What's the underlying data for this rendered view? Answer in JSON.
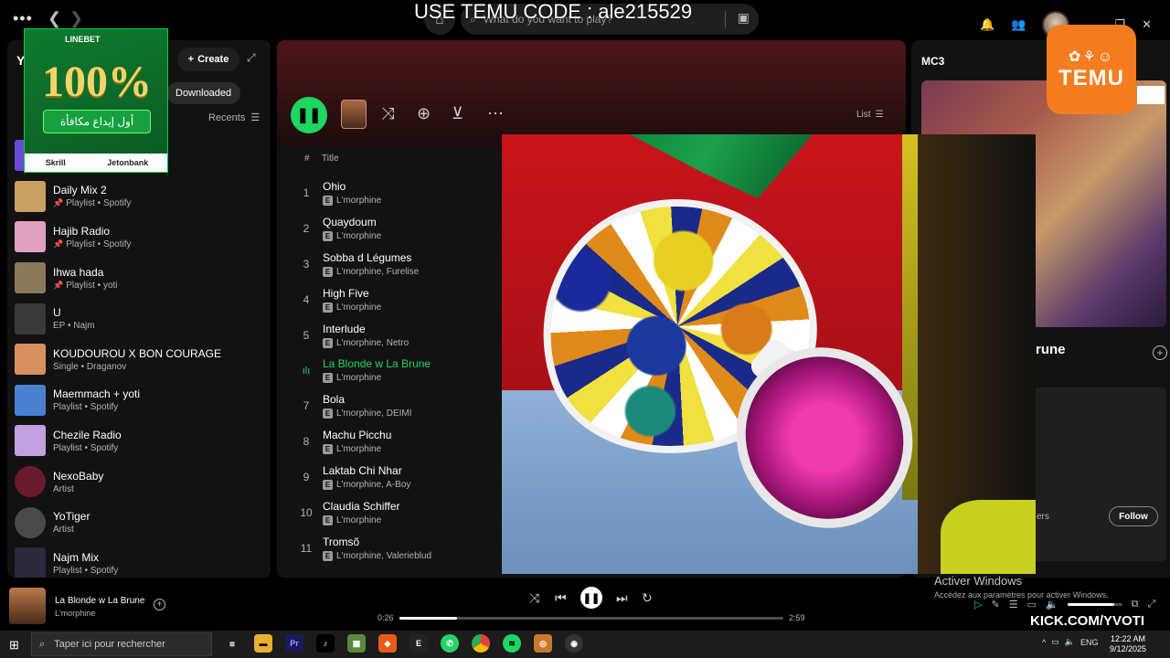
{
  "overlay": {
    "code_text": "USE TEMU CODE : ale215529",
    "temu_label": "TEMU",
    "kick_text": "KICK.COM/YVOTI"
  },
  "topbar": {
    "search_placeholder": "What do you want to play?"
  },
  "sidebar": {
    "title": "Y",
    "create_label": "Create",
    "chip_downloaded": "Downloaded",
    "recents_label": "Recents",
    "items": [
      {
        "name": "",
        "sub": "",
        "color": "#6a4ad8"
      },
      {
        "name": "Daily Mix 2",
        "sub": "Playlist • Spotify",
        "pinned": true,
        "color": "#c8a060"
      },
      {
        "name": "Hajib Radio",
        "sub": "Playlist • Spotify",
        "pinned": true,
        "color": "#e0a0c0"
      },
      {
        "name": "Ihwa hada",
        "sub": "Playlist • yoti",
        "pinned": true,
        "color": "#8a7a5a"
      },
      {
        "name": "U",
        "sub": "EP • Najm",
        "color": "#3a3a3a"
      },
      {
        "name": "KOUDOUROU X BON COURAGE",
        "sub": "Single • Draganov",
        "color": "#d89060"
      },
      {
        "name": "Maemmach + yoti",
        "sub": "Playlist • Spotify",
        "color": "#4a80d0"
      },
      {
        "name": "Chezile Radio",
        "sub": "Playlist • Spotify",
        "color": "#c0a0e0"
      },
      {
        "name": "NexoBaby",
        "sub": "Artist",
        "round": true,
        "color": "#6a1a2a"
      },
      {
        "name": "YoTiger",
        "sub": "Artist",
        "round": true,
        "color": "#4a4a4a"
      },
      {
        "name": "Najm Mix",
        "sub": "Playlist • Spotify",
        "color": "#2a2a3a"
      }
    ]
  },
  "ad": {
    "logo": "LINEBET",
    "big_text": "100%",
    "arabic_text": "أول إيداع مكافأة",
    "footer_left": "Skrill",
    "footer_right": "Jetonbank"
  },
  "main": {
    "list_label": "List",
    "col_hash": "#",
    "col_title": "Title",
    "explicit_badge": "E",
    "tracks": [
      {
        "num": "1",
        "title": "Ohio",
        "artist": "L'morphine"
      },
      {
        "num": "2",
        "title": "Quaydoum",
        "artist": "L'morphine"
      },
      {
        "num": "3",
        "title": "Sobba d Légumes",
        "artist": "L'morphine, Furelise"
      },
      {
        "num": "4",
        "title": "High Five",
        "artist": "L'morphine"
      },
      {
        "num": "5",
        "title": "Interlude",
        "artist": "L'morphine, Netro"
      },
      {
        "num": "",
        "title": "La Blonde w La Brune",
        "artist": "L'morphine",
        "playing": true
      },
      {
        "num": "7",
        "title": "Bola",
        "artist": "L'morphine, DEIMI"
      },
      {
        "num": "8",
        "title": "Machu Picchu",
        "artist": "L'morphine"
      },
      {
        "num": "9",
        "title": "Laktab Chi Nhar",
        "artist": "L'morphine, A-Boy"
      },
      {
        "num": "10",
        "title": "Claudia Schiffer",
        "artist": "L'morphine"
      },
      {
        "num": "11",
        "title": "Tromsõ",
        "artist": "L'morphine, Valerieblud"
      }
    ]
  },
  "right_panel": {
    "title": "MC3",
    "song_partial": "rune",
    "listeners_partial": "ers",
    "follow_label": "Follow"
  },
  "player": {
    "title": "La Blonde w La Brune",
    "artist": "L'morphine",
    "elapsed": "0:26",
    "duration": "2:59",
    "progress_fraction": 0.15,
    "volume_fraction": 0.85
  },
  "windows": {
    "activate_title": "Activer Windows",
    "activate_sub": "Accédez aux paramètres pour activer Windows.",
    "taskbar_search": "Taper ici pour rechercher",
    "lang": "ENG",
    "time": "12:22 AM",
    "date": "9/12/2025"
  }
}
